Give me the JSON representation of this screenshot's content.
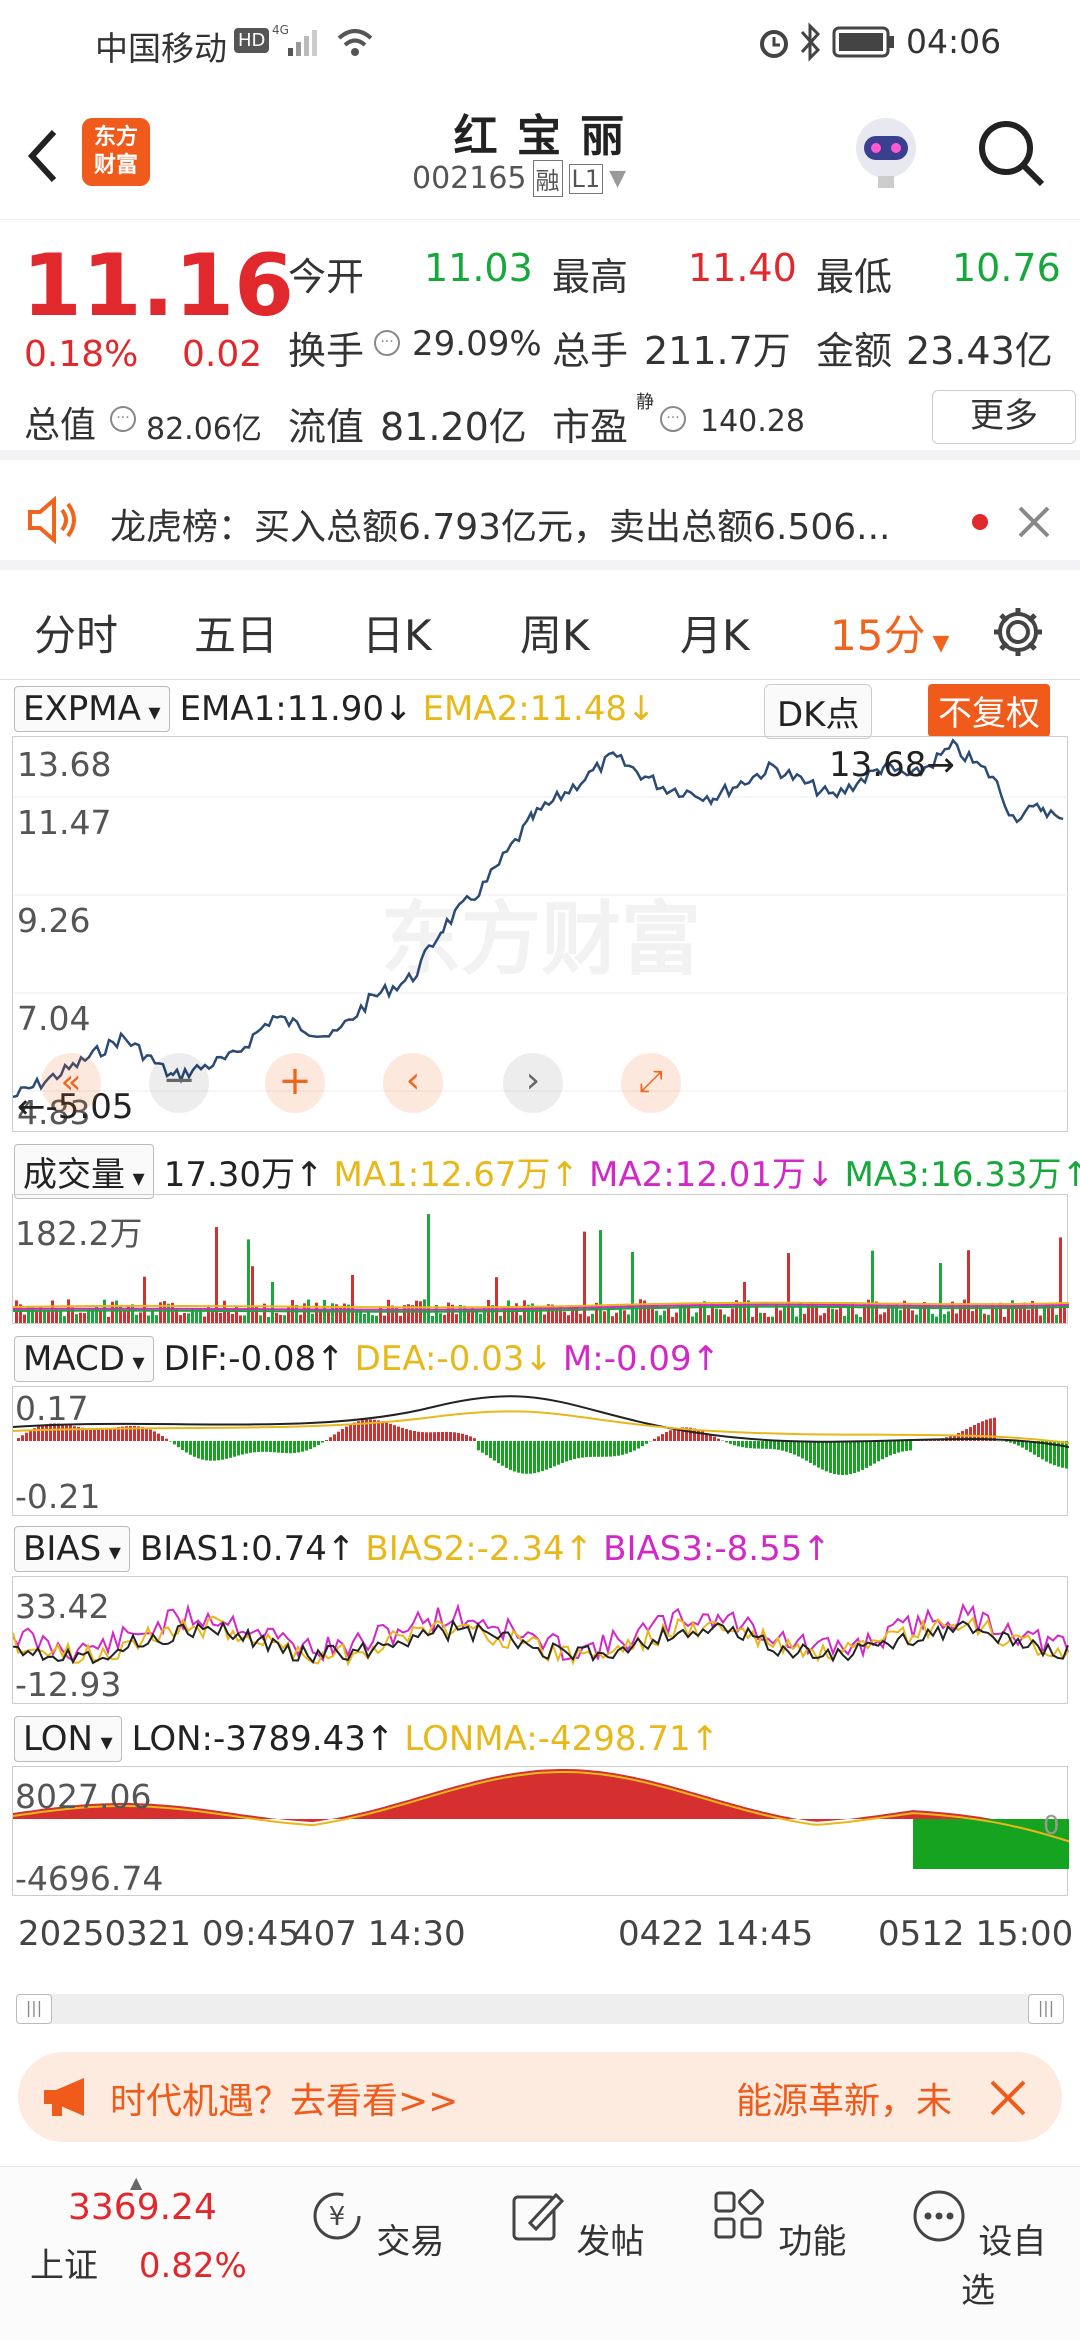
{
  "status_bar": {
    "carrier": "中国移动",
    "time": "04:06"
  },
  "header": {
    "stock_name": "红 宝 丽",
    "code": "002165",
    "tag_margin": "融",
    "tag_level": "L1",
    "brand": "东方\n财富"
  },
  "quote": {
    "price": "11.16",
    "change_pct": "0.18%",
    "change": "0.02",
    "open_label": "今开",
    "open": "11.03",
    "high_label": "最高",
    "high": "11.40",
    "low_label": "最低",
    "low": "10.76",
    "turnover_label": "换手",
    "turnover": "29.09%",
    "volume_label": "总手",
    "volume": "211.7万",
    "amount_label": "金额",
    "amount": "23.43亿",
    "mktcap_label": "总值",
    "mktcap": "82.06亿",
    "float_label": "流值",
    "float_cap": "81.20亿",
    "pe_label": "市盈",
    "pe_sup": "静",
    "pe": "140.28",
    "more_button": "更多"
  },
  "notice": {
    "text": "龙虎榜：买入总额6.793亿元，卖出总额6.506..."
  },
  "tabs": [
    "分时",
    "五日",
    "日K",
    "周K",
    "月K",
    "15分"
  ],
  "main_chart": {
    "indicator": "EXPMA",
    "ema1": "EMA1:11.90↓",
    "ema2": "EMA2:11.48↓",
    "dk_button": "DK点",
    "fq_button": "不复权",
    "y_top": "13.68",
    "y_2": "11.47",
    "y_3": "9.26",
    "y_4": "7.04",
    "y_bottom": "4.83",
    "max_label": "13.68",
    "min_label": "5.05",
    "watermark": "东方财富"
  },
  "volume_panel": {
    "indicator": "成交量",
    "value": "17.30万↑",
    "ma1": "MA1:12.67万↑",
    "ma2": "MA2:12.01万↓",
    "ma3": "MA3:16.33万↑",
    "y_top": "182.2万"
  },
  "macd_panel": {
    "indicator": "MACD",
    "dif": "DIF:-0.08↑",
    "dea": "DEA:-0.03↓",
    "m": "M:-0.09↑",
    "y_top": "0.17",
    "y_bottom": "-0.21"
  },
  "bias_panel": {
    "indicator": "BIAS",
    "bias1": "BIAS1:0.74↑",
    "bias2": "BIAS2:-2.34↑",
    "bias3": "BIAS3:-8.55↑",
    "y_top": "33.42",
    "y_bottom": "-12.93"
  },
  "lon_panel": {
    "indicator": "LON",
    "lon": "LON:-3789.43↑",
    "lonma": "LONMA:-4298.71↑",
    "y_top": "8027.06",
    "y_bottom": "-4696.74",
    "zero": "0"
  },
  "time_axis": {
    "start": "20250321 09:45",
    "start_overlap": "407 14:30",
    "mid": "0422 14:45",
    "end": "0512 15:00"
  },
  "ad_banner": {
    "left": "时代机遇？去看看>>",
    "right": "能源革新，未"
  },
  "bottom_nav": {
    "index_value": "3369.24",
    "index_name": "上证",
    "index_change": "0.82%",
    "items": [
      "交易",
      "发帖",
      "功能",
      "设自选"
    ]
  },
  "colors": {
    "up": "#e0282d",
    "down": "#16a83a",
    "accent": "#f0641e",
    "line": "#2b4a75"
  }
}
